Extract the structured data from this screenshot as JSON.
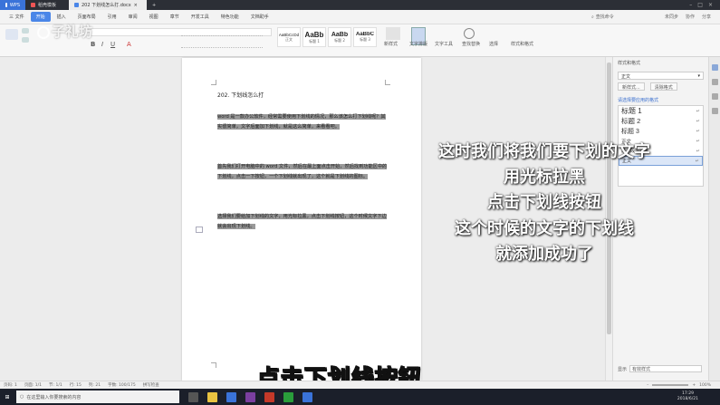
{
  "tabs": {
    "wps": "WPS",
    "tab1": "稻壳模板",
    "tab2": "202 下划线怎么打.docx"
  },
  "menus": [
    "三 文件",
    "开始",
    "插入",
    "页面布局",
    "引用",
    "审阅",
    "视图",
    "章节",
    "开发工具",
    "特色功能",
    "文档助手"
  ],
  "menu_active": "开始",
  "menu_search": "查找命令",
  "menu_right": [
    "未同步",
    "协作",
    "分享"
  ],
  "ribbon": {
    "style_samples": [
      {
        "sample": "AaBbCcDd",
        "name": "正文"
      },
      {
        "sample": "AaBb",
        "name": "标题 1"
      },
      {
        "sample": "AaBb",
        "name": "标题 2"
      },
      {
        "sample": "AaBbC",
        "name": "标题 3"
      }
    ],
    "labels": {
      "new_style": "新样式",
      "text_layout": "文字排版",
      "find_replace": "查找替换",
      "select": "选择",
      "styles_format": "样式和格式"
    }
  },
  "document": {
    "title": "202. 下划线怎么打",
    "paragraphs": [
      "word 是一款办公软件，经常需要使用下划线的情况，那么该怎么打下划线呢？其实很简单，文字后面加下划线，就是这么简单，来看看吧。",
      "首先我们打开电脑中的 word 文件，然后在最上面点击开始，然后找到功能区中的下划线，点击一下按钮，一个下划线就出现了，这个就是下划线的图标。",
      "选择我们要给加下划线的文字，用光标拉黑，点击下划线按钮，这个时候文字下边就会出现下划线。"
    ]
  },
  "overlay_lines": [
    "这时我们将我们要下划的文字",
    "用光标拉黑",
    "点击下划线按钮",
    "这个时候的文字的下划线",
    "就添加成功了"
  ],
  "subtitle": "点击下划线按钮",
  "watermark": "子礼坊",
  "panel": {
    "title": "样式和格式",
    "current_style": "正文",
    "btn_new": "新样式...",
    "btn_clear": "清除格式",
    "list_label": "请选择要应用的格式",
    "styles": [
      "标题 1",
      "标题 2",
      "标题 3",
      "正文",
      "默认段落字体",
      "正文"
    ],
    "show_label": "显示",
    "show_value": "有效样式"
  },
  "status": {
    "page": "页码: 1",
    "pages": "页面: 1/1",
    "section": "节: 1/1",
    "row": "行: 15",
    "col": "列: 21",
    "words": "字数: 100/175",
    "spell": "拼写检查",
    "zoom": "100%"
  },
  "taskbar": {
    "search": "在这里输入你要搜索的内容",
    "time": "17:29",
    "date": "2018/6/21"
  },
  "colors": {
    "wps_blue": "#3a73d9",
    "highlight": "#9a9a9a",
    "taskbar": "#1b1f2a"
  }
}
